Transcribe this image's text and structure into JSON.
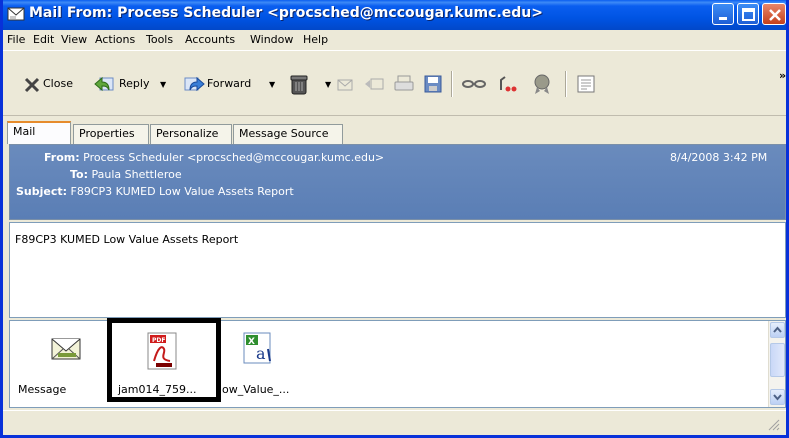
{
  "window": {
    "title": "Mail From: Process Scheduler <procsched@mccougar.kumc.edu>",
    "controls": [
      "minimize",
      "maximize",
      "close"
    ]
  },
  "menubar": {
    "items": [
      "File",
      "Edit",
      "View",
      "Actions",
      "Tools",
      "Accounts",
      "Window",
      "Help"
    ]
  },
  "toolbar": {
    "close_label": "Close",
    "reply_label": "Reply",
    "forward_label": "Forward",
    "overflow": "»"
  },
  "tabs": [
    "Mail",
    "Properties",
    "Personalize",
    "Message Source"
  ],
  "header": {
    "from_label": "From:",
    "from_value": "Process Scheduler <procsched@mccougar.kumc.edu>",
    "date": "8/4/2008 3:42 PM",
    "to_label": "To:",
    "to_value": "Paula Shettleroe",
    "subject_label": "Subject:",
    "subject_value": "F89CP3  KUMED Low Value Assets Report"
  },
  "body": {
    "text": "F89CP3  KUMED Low Value Assets Report"
  },
  "attachments": [
    {
      "name": "Message",
      "icon": "message-envelope-icon"
    },
    {
      "name": "jam014_759...",
      "icon": "pdf-file-icon"
    },
    {
      "name": "ow_Value_...",
      "icon": "excel-file-icon"
    }
  ],
  "colors": {
    "titlebar": "#0054e3",
    "header_bg": "#6083b8",
    "highlight": "#000000"
  }
}
